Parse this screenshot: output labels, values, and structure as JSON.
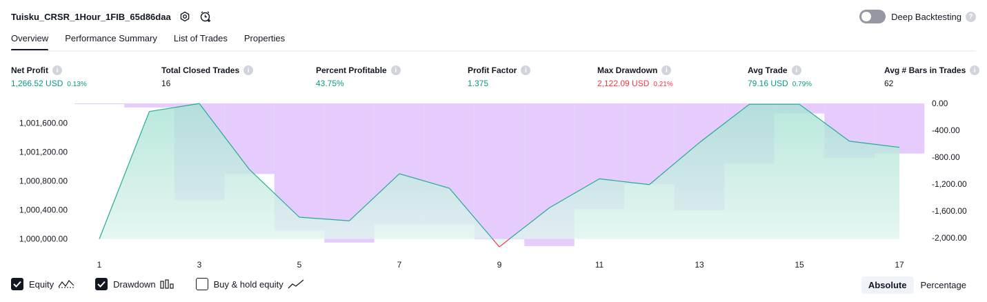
{
  "header": {
    "strategy_name": "Tuisku_CRSR_1Hour_1FIB_65d86daa",
    "deep_backtesting_label": "Deep Backtesting"
  },
  "tabs": [
    {
      "label": "Overview"
    },
    {
      "label": "Performance Summary"
    },
    {
      "label": "List of Trades"
    },
    {
      "label": "Properties"
    }
  ],
  "metrics": [
    {
      "label": "Net Profit",
      "value": "1,266.52 USD",
      "pct": "0.13%",
      "color": "#089981"
    },
    {
      "label": "Total Closed Trades",
      "value": "16",
      "pct": "",
      "color": "#131722"
    },
    {
      "label": "Percent Profitable",
      "value": "43.75%",
      "pct": "",
      "color": "#089981"
    },
    {
      "label": "Profit Factor",
      "value": "1.375",
      "pct": "",
      "color": "#089981"
    },
    {
      "label": "Max Drawdown",
      "value": "2,122.09 USD",
      "pct": "0.21%",
      "color": "#f23645"
    },
    {
      "label": "Avg Trade",
      "value": "79.16 USD",
      "pct": "0.79%",
      "color": "#089981"
    },
    {
      "label": "Avg # Bars in Trades",
      "value": "62",
      "pct": "",
      "color": "#131722"
    }
  ],
  "legend": {
    "equity": "Equity",
    "drawdown": "Drawdown",
    "buy_hold": "Buy & hold equity"
  },
  "modes": {
    "absolute": "Absolute",
    "percentage": "Percentage"
  },
  "chart_data": {
    "type": "line",
    "x_ticks": [
      "1",
      "3",
      "5",
      "7",
      "9",
      "11",
      "13",
      "15",
      "17"
    ],
    "left_ticks": [
      "1,001,600.00",
      "1,001,200.00",
      "1,000,800.00",
      "1,000,400.00",
      "1,000,000.00"
    ],
    "right_ticks": [
      "0.00",
      "-400.00",
      "-800.00",
      "-1,200.00",
      "-1,600.00",
      "-2,000.00"
    ],
    "left_ylim": [
      1000000,
      1001600
    ],
    "right_ylim": [
      -2000,
      0
    ],
    "series": [
      {
        "name": "Equity",
        "type": "area",
        "color": "#22ab94",
        "x": [
          1,
          2,
          3,
          4,
          5,
          6,
          7,
          8,
          9,
          10,
          11,
          12,
          13,
          14,
          15,
          16,
          17
        ],
        "values": [
          1000000,
          1001760,
          1001870,
          1000960,
          1000300,
          1000250,
          1000900,
          1000700,
          999890,
          1000430,
          1000830,
          1000750,
          1001330,
          1001860,
          1001860,
          1001350,
          1001265
        ]
      },
      {
        "name": "Drawdown",
        "type": "bar",
        "color": "#e1c3fd",
        "x": [
          1,
          2,
          3,
          4,
          5,
          6,
          7,
          8,
          9,
          10,
          11,
          12,
          13,
          14,
          15,
          16,
          17
        ],
        "values": [
          0,
          -60,
          -1440,
          -1050,
          -1890,
          -2070,
          -1800,
          -1800,
          -2020,
          -2122,
          -1570,
          -1200,
          -1590,
          -900,
          -150,
          -810,
          -745
        ]
      }
    ],
    "grid": false
  }
}
